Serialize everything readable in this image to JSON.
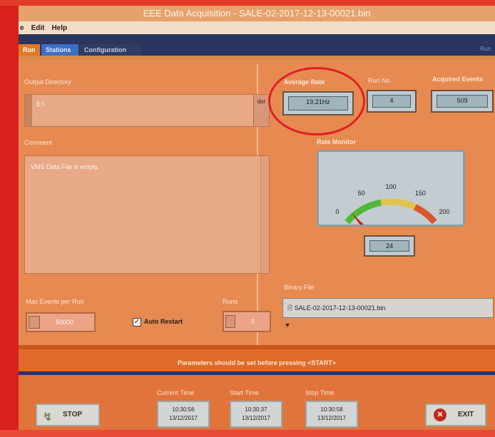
{
  "window": {
    "title": "EEE Data Acquisition - SALE-02-2017-12-13-00021.bin"
  },
  "menu": {
    "items": [
      "e",
      "Edit",
      "Help"
    ]
  },
  "tabs": {
    "run": "Run",
    "stations": "Stations",
    "configuration": "Configuration",
    "right_text": "Run"
  },
  "output_directory": {
    "label": "Output Directory",
    "value": "E:\\",
    "browse_label": "dor"
  },
  "comment": {
    "label": "Comment",
    "text": "VMS Data File is empty."
  },
  "max_events": {
    "label": "Max Events per Run",
    "value": "50000"
  },
  "auto_restart": {
    "label": "Auto Restart",
    "checked": true
  },
  "runs": {
    "label": "Runs",
    "value": "0"
  },
  "average_rate": {
    "label": "Average Rate",
    "value": "19.21Hz"
  },
  "run_no": {
    "label": "Run No.",
    "value": "4"
  },
  "acquired_events": {
    "label": "Acquired Events",
    "value": "509"
  },
  "rate_monitor": {
    "label": "Rate Monitor",
    "ticks": [
      "0",
      "50",
      "100",
      "150",
      "200"
    ],
    "min": 0,
    "max": 200,
    "value": 19,
    "readout": "24"
  },
  "binary_file": {
    "label": "Binary File",
    "value": "SALE-02-2017-12-13-00021.bin"
  },
  "message": "Parameters should be set before pressing <START>",
  "current_time": {
    "label": "Current Time",
    "time": "10:30:56",
    "date": "13/12/2017"
  },
  "start_time": {
    "label": "Start Time",
    "time": "10:30:37",
    "date": "13/12/2017"
  },
  "stop_time": {
    "label": "Stop Time",
    "time": "10:30:58",
    "date": "13/12/2017"
  },
  "buttons": {
    "stop": "STOP",
    "exit": "EXIT"
  },
  "colors": {
    "panel": "#e68a52",
    "tab_active": "#3c6fc0",
    "highlight_circle": "#e02020"
  }
}
